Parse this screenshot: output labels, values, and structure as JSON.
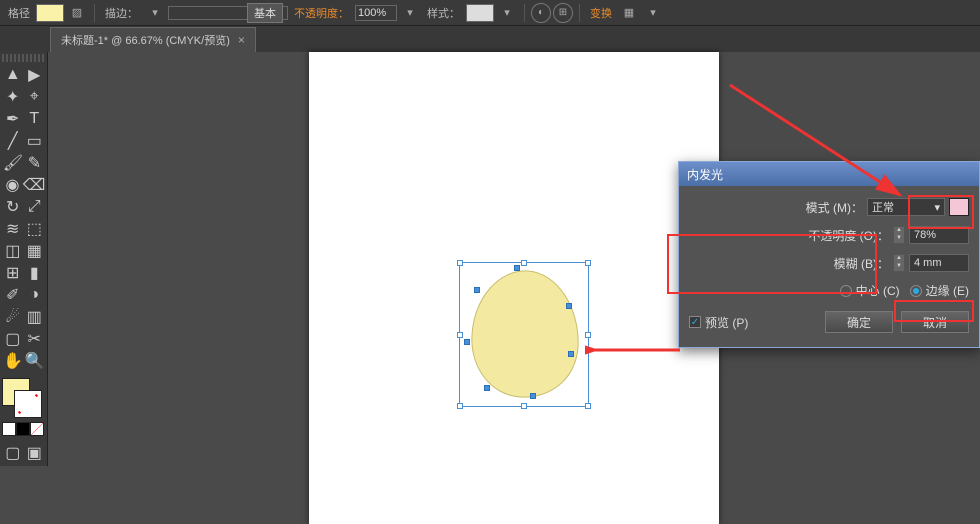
{
  "topbar": {
    "path_label": "格径",
    "stroke_label": "描边：",
    "stroke_style": "基本",
    "opacity_label": "不透明度：",
    "opacity_value": "100%",
    "style_label": "样式：",
    "transform_label": "变换"
  },
  "tab": {
    "title": "未标题-1* @ 66.67% (CMYK/预览)",
    "close": "×"
  },
  "dialog": {
    "title": "内发光",
    "mode_label": "模式 (M)：",
    "mode_value": "正常",
    "opacity_label": "不透明度 (O)：",
    "opacity_value": "78%",
    "blur_label": "模糊 (B)：",
    "blur_value": "4 mm",
    "center_label": "中心 (C)",
    "edge_label": "边缘 (E)",
    "preview_label": "预览 (P)",
    "ok": "确定",
    "cancel": "取消"
  }
}
